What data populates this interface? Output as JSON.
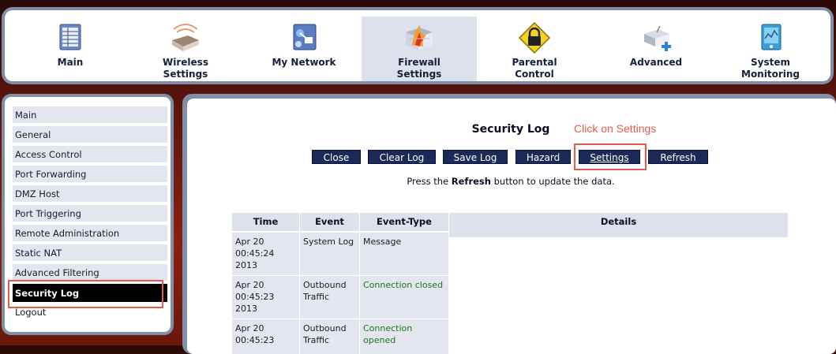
{
  "nav": {
    "items": [
      {
        "label": "Main",
        "icon": "main-table-icon"
      },
      {
        "label": "Wireless\nSettings",
        "icon": "wireless-router-icon"
      },
      {
        "label": "My Network",
        "icon": "my-network-icon"
      },
      {
        "label": "Firewall\nSettings",
        "icon": "firewall-icon"
      },
      {
        "label": "Parental\nControl",
        "icon": "parental-lock-icon"
      },
      {
        "label": "Advanced",
        "icon": "advanced-router-icon"
      },
      {
        "label": "System\nMonitoring",
        "icon": "system-monitoring-icon"
      }
    ],
    "active_index": 3
  },
  "sidebar": {
    "items": [
      {
        "label": "Main"
      },
      {
        "label": "General"
      },
      {
        "label": "Access Control"
      },
      {
        "label": "Port Forwarding"
      },
      {
        "label": "DMZ Host"
      },
      {
        "label": "Port Triggering"
      },
      {
        "label": "Remote Administration"
      },
      {
        "label": "Static NAT"
      },
      {
        "label": "Advanced Filtering"
      },
      {
        "label": "Security Log"
      },
      {
        "label": "Logout"
      }
    ],
    "active_index": 9
  },
  "main": {
    "title": "Security Log",
    "annotation": "Click on Settings",
    "buttons": {
      "close": "Close",
      "clear_log": "Clear Log",
      "save_log": "Save Log",
      "hazard": "Hazard",
      "settings": "Settings",
      "refresh": "Refresh"
    },
    "help": {
      "before": "Press the ",
      "bold": "Refresh",
      "after": " button to update the data."
    },
    "table": {
      "headers": {
        "time": "Time",
        "event": "Event",
        "event_type": "Event-Type",
        "details": "Details"
      },
      "rows": [
        {
          "time": "Apr 20\n00:45:24\n2013",
          "event": "System Log",
          "event_type": "Message"
        },
        {
          "time": "Apr 20\n00:45:23\n2013",
          "event": "Outbound\nTraffic",
          "event_type": "Connection closed"
        },
        {
          "time": "Apr 20\n00:45:23",
          "event": "Outbound\nTraffic",
          "event_type": "Connection\nopened"
        }
      ]
    }
  },
  "colors": {
    "accent_red": "#e35b50",
    "button_navy": "#1c2a5a",
    "status_green": "#1a7a1a"
  }
}
